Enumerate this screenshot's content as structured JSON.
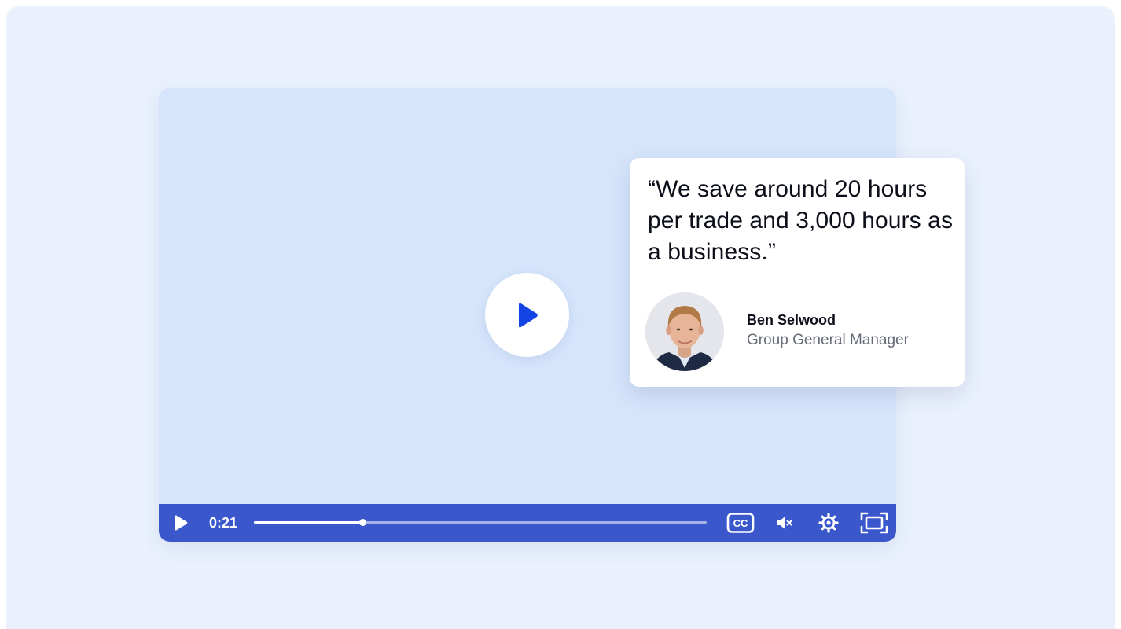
{
  "player": {
    "current_time": "0:21",
    "progress": 0.24,
    "big_play_icon": "play-icon",
    "controls": {
      "play_icon": "play-icon",
      "captions_icon": "closed-captions-icon",
      "captions_label": "CC",
      "mute_icon": "volume-muted-icon",
      "settings_icon": "gear-icon",
      "fullscreen_icon": "fullscreen-icon"
    }
  },
  "testimonial": {
    "quote": "“We save around 20 hours per trade and 3,000 hours as a business.”",
    "name": "Ben Selwood",
    "role": "Group General Manager"
  },
  "colors": {
    "background": "#eaf1fd",
    "player_surface": "#d6e5fb",
    "control_bar": "#3a57cc",
    "play_accent": "#1244e6",
    "quote_text": "#0c0f1a",
    "role_text": "#666b78"
  }
}
